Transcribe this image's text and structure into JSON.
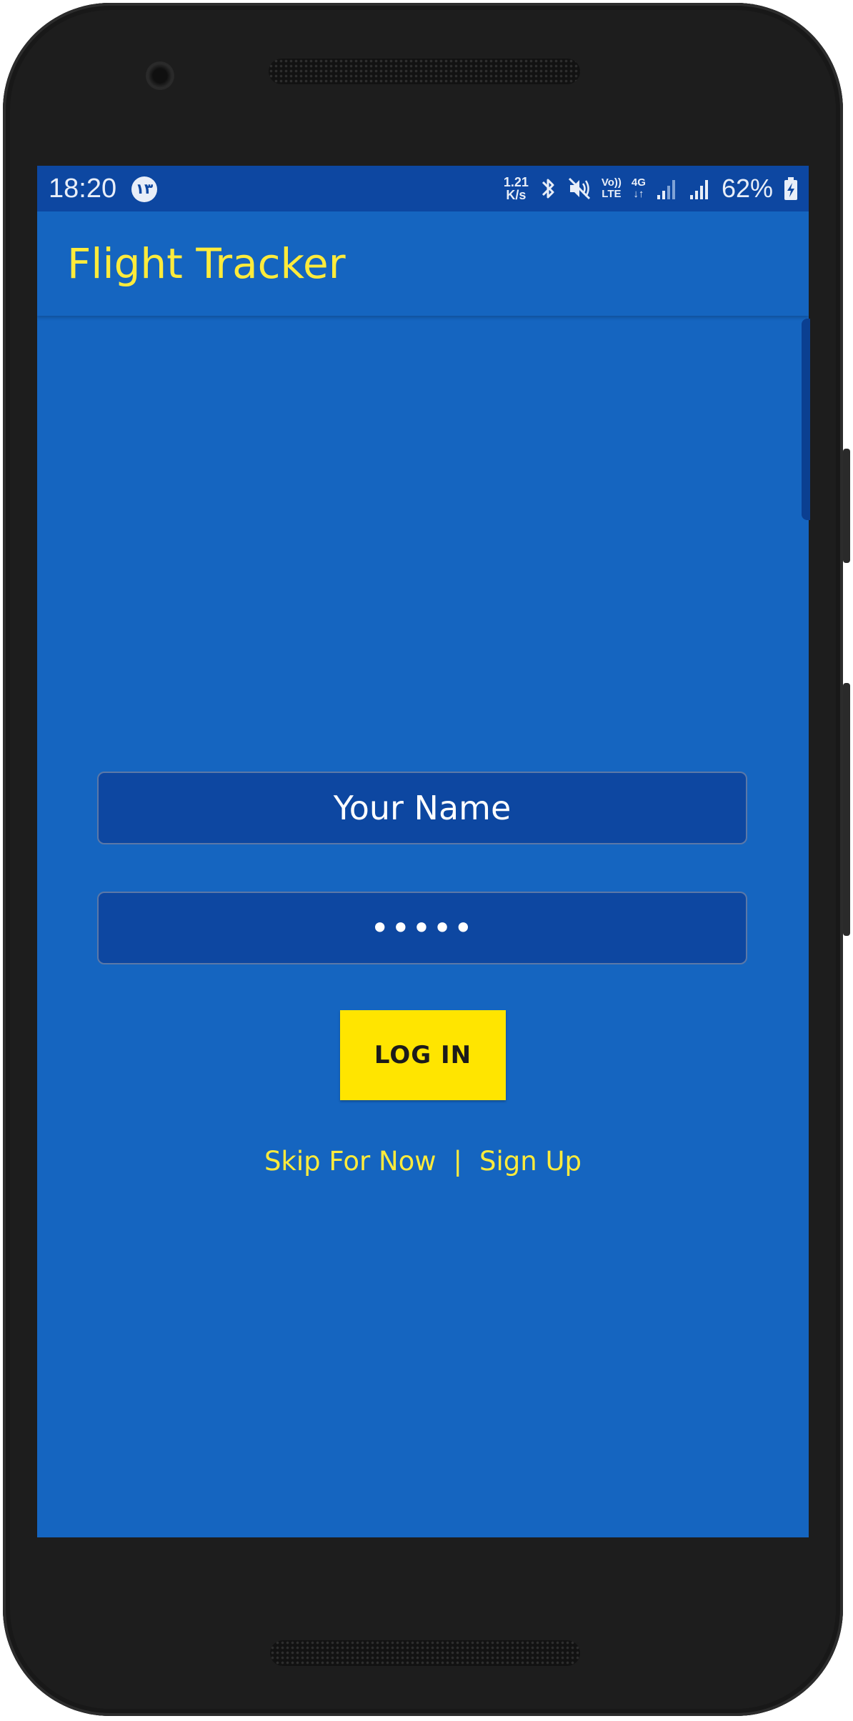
{
  "status_bar": {
    "time": "18:20",
    "notification_badge": "۱۳",
    "net_speed_value": "1.21",
    "net_speed_unit": "K/s",
    "volte_top": "Vo))",
    "volte_bottom": "LTE",
    "network_type": "4G",
    "network_arrows": "↓↑",
    "battery_percent": "62%"
  },
  "app_bar": {
    "title": "Flight Tracker"
  },
  "login_form": {
    "name_field_value": "Your Name",
    "password_field_value": "•••••",
    "login_button_label": "LOG IN",
    "skip_link": "Skip For Now",
    "separator": "|",
    "signup_link": "Sign Up"
  },
  "colors": {
    "primary": "#1565c0",
    "primary_dark": "#0d47a1",
    "accent": "#ffeb3b",
    "button": "#ffe500"
  },
  "icons": [
    "bluetooth-icon",
    "mute-icon",
    "signal-icon",
    "battery-charging-icon"
  ]
}
